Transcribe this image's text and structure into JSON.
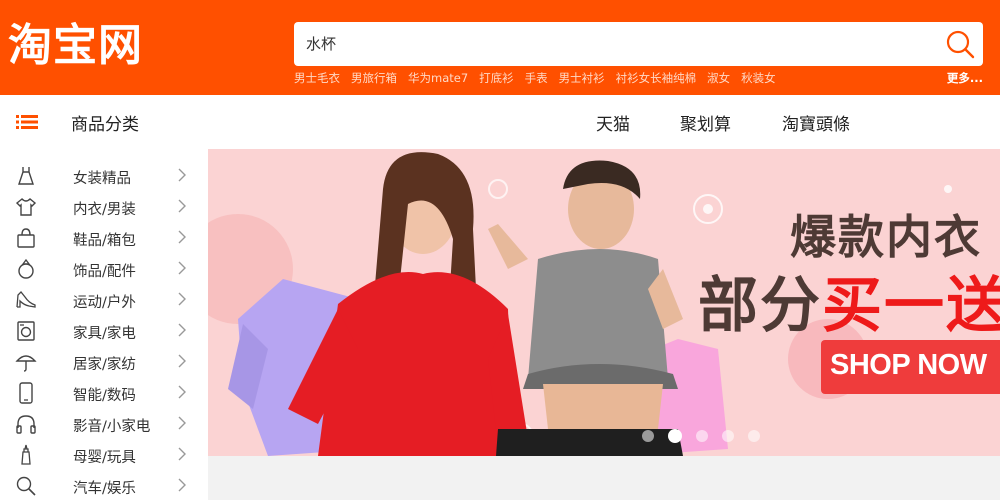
{
  "header": {
    "logo": "淘宝网",
    "search": {
      "placeholder": "水杯",
      "value": ""
    },
    "hotwords": [
      "男士毛衣",
      "男旅行箱",
      "华为mate7",
      "打底衫",
      "手表",
      "男士衬衫",
      "衬衫女长袖纯棉",
      "淑女",
      "秋装女"
    ],
    "more": "更多..."
  },
  "nav": {
    "category_title": "商品分类",
    "links": [
      "天猫",
      "聚划算",
      "淘寶頭條"
    ]
  },
  "sidebar": {
    "items": [
      {
        "label": "女装精品",
        "icon": "dress-icon"
      },
      {
        "label": "内衣/男装",
        "icon": "shirt-icon"
      },
      {
        "label": "鞋品/箱包",
        "icon": "bag-icon"
      },
      {
        "label": "饰品/配件",
        "icon": "ring-icon"
      },
      {
        "label": "运动/户外",
        "icon": "high-heel-icon"
      },
      {
        "label": "家具/家电",
        "icon": "washing-machine-icon"
      },
      {
        "label": "居家/家纺",
        "icon": "umbrella-icon"
      },
      {
        "label": "智能/数码",
        "icon": "phone-icon"
      },
      {
        "label": "影音/小家电",
        "icon": "headphones-icon"
      },
      {
        "label": "母婴/玩具",
        "icon": "baby-bottle-icon"
      },
      {
        "label": "汽车/娱乐",
        "icon": "search-tool-icon"
      }
    ]
  },
  "banner": {
    "line1": "爆款内衣",
    "line2_a": "部分",
    "line2_b": "买一送",
    "cta": "SHOP NOW",
    "dots": 5,
    "active_dot": 1
  },
  "colors": {
    "brand": "#ff5000",
    "banner_bg": "#fbd3d3",
    "cta": "#ef3c3c"
  }
}
